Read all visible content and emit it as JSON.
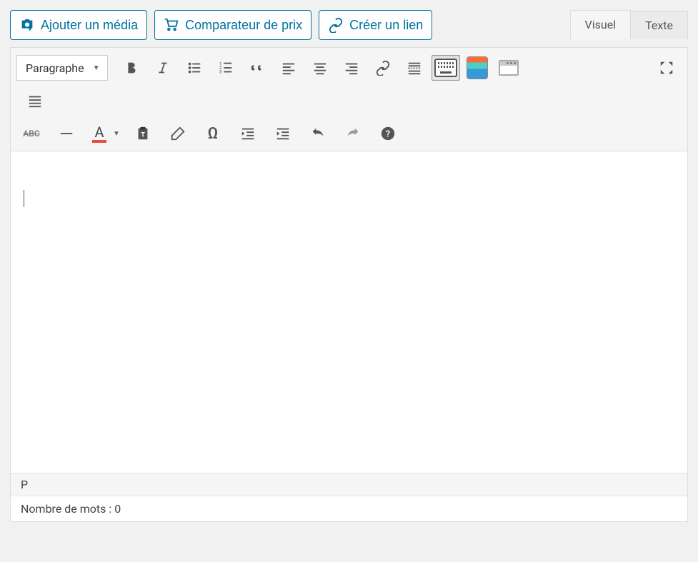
{
  "buttons": {
    "add_media": "Ajouter un média",
    "price_compare": "Comparateur de prix",
    "create_link": "Créer un lien"
  },
  "tabs": {
    "visual": "Visuel",
    "text": "Texte"
  },
  "toolbar": {
    "format_select": "Paragraphe",
    "text_color_letter": "A",
    "strike_label": "ABC"
  },
  "status": {
    "path": "P",
    "word_count_label": "Nombre de mots :",
    "word_count_value": "0"
  }
}
